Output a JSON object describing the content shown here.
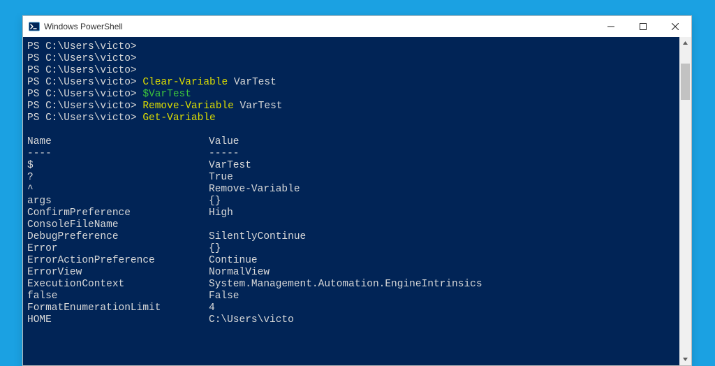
{
  "window": {
    "title": "Windows PowerShell"
  },
  "prompt": "PS C:\\Users\\victo>",
  "commands": [
    {
      "prompt": "PS C:\\Users\\victo>",
      "cmd": "",
      "arg": ""
    },
    {
      "prompt": "PS C:\\Users\\victo>",
      "cmd": "",
      "arg": ""
    },
    {
      "prompt": "PS C:\\Users\\victo>",
      "cmd": "",
      "arg": ""
    },
    {
      "prompt": "PS C:\\Users\\victo>",
      "cmd": "Clear-Variable",
      "arg": "VarTest"
    },
    {
      "prompt": "PS C:\\Users\\victo>",
      "cmd": "$VarTest",
      "arg": "",
      "var": true
    },
    {
      "prompt": "PS C:\\Users\\victo>",
      "cmd": "Remove-Variable",
      "arg": "VarTest"
    },
    {
      "prompt": "PS C:\\Users\\victo>",
      "cmd": "Get-Variable",
      "arg": ""
    }
  ],
  "table": {
    "headers": {
      "name": "Name",
      "value": "Value"
    },
    "separators": {
      "name": "----",
      "value": "-----"
    },
    "rows": [
      {
        "name": "$",
        "value": "VarTest"
      },
      {
        "name": "?",
        "value": "True"
      },
      {
        "name": "^",
        "value": "Remove-Variable"
      },
      {
        "name": "args",
        "value": "{}"
      },
      {
        "name": "ConfirmPreference",
        "value": "High"
      },
      {
        "name": "ConsoleFileName",
        "value": ""
      },
      {
        "name": "DebugPreference",
        "value": "SilentlyContinue"
      },
      {
        "name": "Error",
        "value": "{}"
      },
      {
        "name": "ErrorActionPreference",
        "value": "Continue"
      },
      {
        "name": "ErrorView",
        "value": "NormalView"
      },
      {
        "name": "ExecutionContext",
        "value": "System.Management.Automation.EngineIntrinsics"
      },
      {
        "name": "false",
        "value": "False"
      },
      {
        "name": "FormatEnumerationLimit",
        "value": "4"
      },
      {
        "name": "HOME",
        "value": "C:\\Users\\victo"
      }
    ]
  },
  "colors": {
    "console_bg": "#012456",
    "console_fg": "#d9d9d9",
    "cmd_yellow": "#dede00",
    "var_green": "#3cc23c",
    "desktop_bg": "#1ba1e2"
  }
}
